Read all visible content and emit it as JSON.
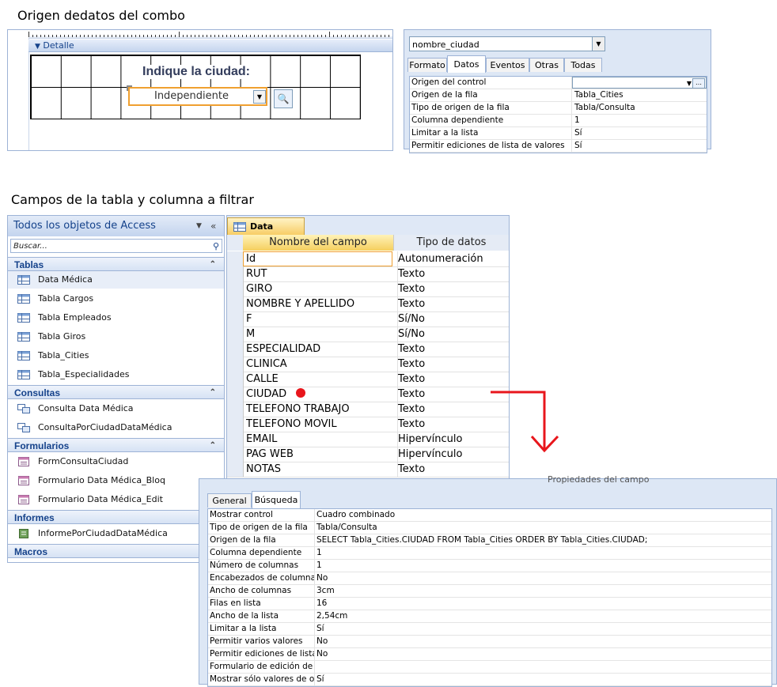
{
  "section1": {
    "heading": "Origen dedatos del combo",
    "designer": {
      "section_label": "Detalle",
      "label_text": "Indique la ciudad:",
      "combo_value": "Independiente"
    },
    "property_sheet": {
      "object_selector": "nombre_ciudad",
      "tabs": [
        "Formato",
        "Datos",
        "Eventos",
        "Otras",
        "Todas"
      ],
      "active_tab": "Datos",
      "rows": [
        {
          "name": "Origen del control",
          "value": ""
        },
        {
          "name": "Origen de la fila",
          "value": "Tabla_Cities"
        },
        {
          "name": "Tipo de origen de la fila",
          "value": "Tabla/Consulta"
        },
        {
          "name": "Columna dependiente",
          "value": "1"
        },
        {
          "name": "Limitar a la lista",
          "value": "Sí"
        },
        {
          "name": "Permitir ediciones de lista de valores",
          "value": "Sí"
        }
      ]
    }
  },
  "section2": {
    "heading": "Campos de la tabla y columna a filtrar",
    "nav": {
      "title": "Todos los objetos de Access",
      "search_placeholder": "Buscar...",
      "groups": [
        {
          "label": "Tablas",
          "items": [
            "Data Médica",
            "Tabla Cargos",
            "Tabla Empleados",
            "Tabla Giros",
            "Tabla_Cities",
            "Tabla_Especialidades"
          ]
        },
        {
          "label": "Consultas",
          "items": [
            "Consulta Data Médica",
            "ConsultaPorCiudadDataMédica"
          ]
        },
        {
          "label": "Formularios",
          "items": [
            "FormConsultaCiudad",
            "Formulario Data Médica_Bloq",
            "Formulario Data Médica_Edit"
          ]
        },
        {
          "label": "Informes",
          "items": [
            "InformePorCiudadDataMédica"
          ]
        },
        {
          "label": "Macros",
          "items": []
        }
      ]
    },
    "table_design": {
      "tab_label": "Data Médica",
      "col_name": "Nombre del campo",
      "col_type": "Tipo de datos",
      "fields": [
        {
          "name": "Id",
          "type": "Autonumeración"
        },
        {
          "name": "RUT",
          "type": "Texto"
        },
        {
          "name": "GIRO",
          "type": "Texto"
        },
        {
          "name": "NOMBRE Y APELLIDO",
          "type": "Texto"
        },
        {
          "name": "F",
          "type": "Sí/No"
        },
        {
          "name": "M",
          "type": "Sí/No"
        },
        {
          "name": "ESPECIALIDAD",
          "type": "Texto"
        },
        {
          "name": "CLINICA",
          "type": "Texto"
        },
        {
          "name": "CALLE",
          "type": "Texto"
        },
        {
          "name": "CIUDAD",
          "type": "Texto"
        },
        {
          "name": "TELEFONO TRABAJO",
          "type": "Texto"
        },
        {
          "name": "TELEFONO MOVIL",
          "type": "Texto"
        },
        {
          "name": "EMAIL",
          "type": "Hipervínculo"
        },
        {
          "name": "PAG WEB",
          "type": "Hipervínculo"
        },
        {
          "name": "NOTAS",
          "type": "Texto"
        }
      ]
    },
    "field_properties": {
      "title": "Propiedades del campo",
      "tabs": [
        "General",
        "Búsqueda"
      ],
      "active_tab": "Búsqueda",
      "rows": [
        {
          "name": "Mostrar control",
          "value": "Cuadro combinado"
        },
        {
          "name": "Tipo de origen de la fila",
          "value": "Tabla/Consulta"
        },
        {
          "name": "Origen de la fila",
          "value": "SELECT Tabla_Cities.CIUDAD FROM Tabla_Cities ORDER BY Tabla_Cities.CIUDAD;"
        },
        {
          "name": "Columna dependiente",
          "value": "1"
        },
        {
          "name": "Número de columnas",
          "value": "1"
        },
        {
          "name": "Encabezados de columna",
          "value": "No"
        },
        {
          "name": "Ancho de columnas",
          "value": "3cm"
        },
        {
          "name": "Filas en lista",
          "value": "16"
        },
        {
          "name": "Ancho de la lista",
          "value": "2,54cm"
        },
        {
          "name": "Limitar a la lista",
          "value": "Sí"
        },
        {
          "name": "Permitir varios valores",
          "value": "No"
        },
        {
          "name": "Permitir ediciones de lista",
          "value": "No"
        },
        {
          "name": "Formulario de edición de",
          "value": ""
        },
        {
          "name": "Mostrar sólo valores de o",
          "value": "Sí"
        }
      ]
    }
  },
  "icons": {
    "table": "table-icon",
    "query": "query-icon",
    "form": "form-icon",
    "report": "report-icon",
    "search": "magnifier-icon",
    "build": "builder-icon"
  },
  "colors": {
    "accent_blue": "#15428b",
    "selection_orange": "#f0a030",
    "marker_red": "#e8161c"
  }
}
